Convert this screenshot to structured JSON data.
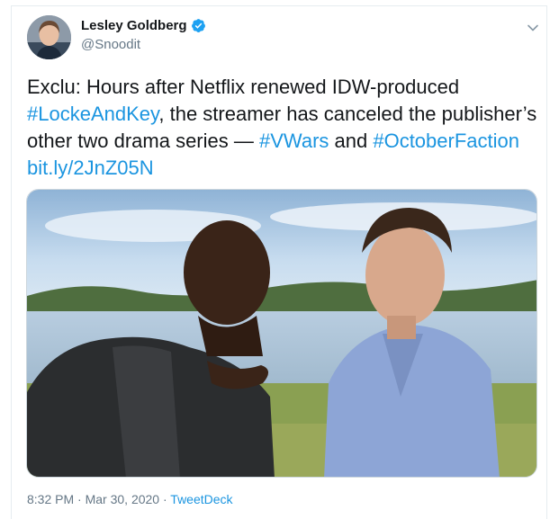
{
  "tweet": {
    "author": {
      "display_name": "Lesley Goldberg",
      "handle": "@Snoodit",
      "verified": true,
      "avatar_icon": "user-avatar"
    },
    "text": {
      "part1": "Exclu: Hours after Netflix renewed IDW-produced ",
      "hashtag1": "#LockeAndKey",
      "part2": ", the streamer has canceled the publisher’s other two drama series — ",
      "hashtag2": "#VWars",
      "part3": " and ",
      "hashtag3": "#OctoberFaction",
      "part4": " ",
      "link": "bit.ly/2JnZ05N"
    },
    "meta": {
      "time": "8:32 PM",
      "separator1": " · ",
      "date": "Mar 30, 2020",
      "separator2": " · ",
      "source": "TweetDeck"
    }
  },
  "colors": {
    "link": "#1b95e0",
    "secondary_text": "#657786",
    "verified_badge": "#1da1f2"
  },
  "icons": [
    "verified-badge-icon",
    "chevron-down-icon"
  ]
}
